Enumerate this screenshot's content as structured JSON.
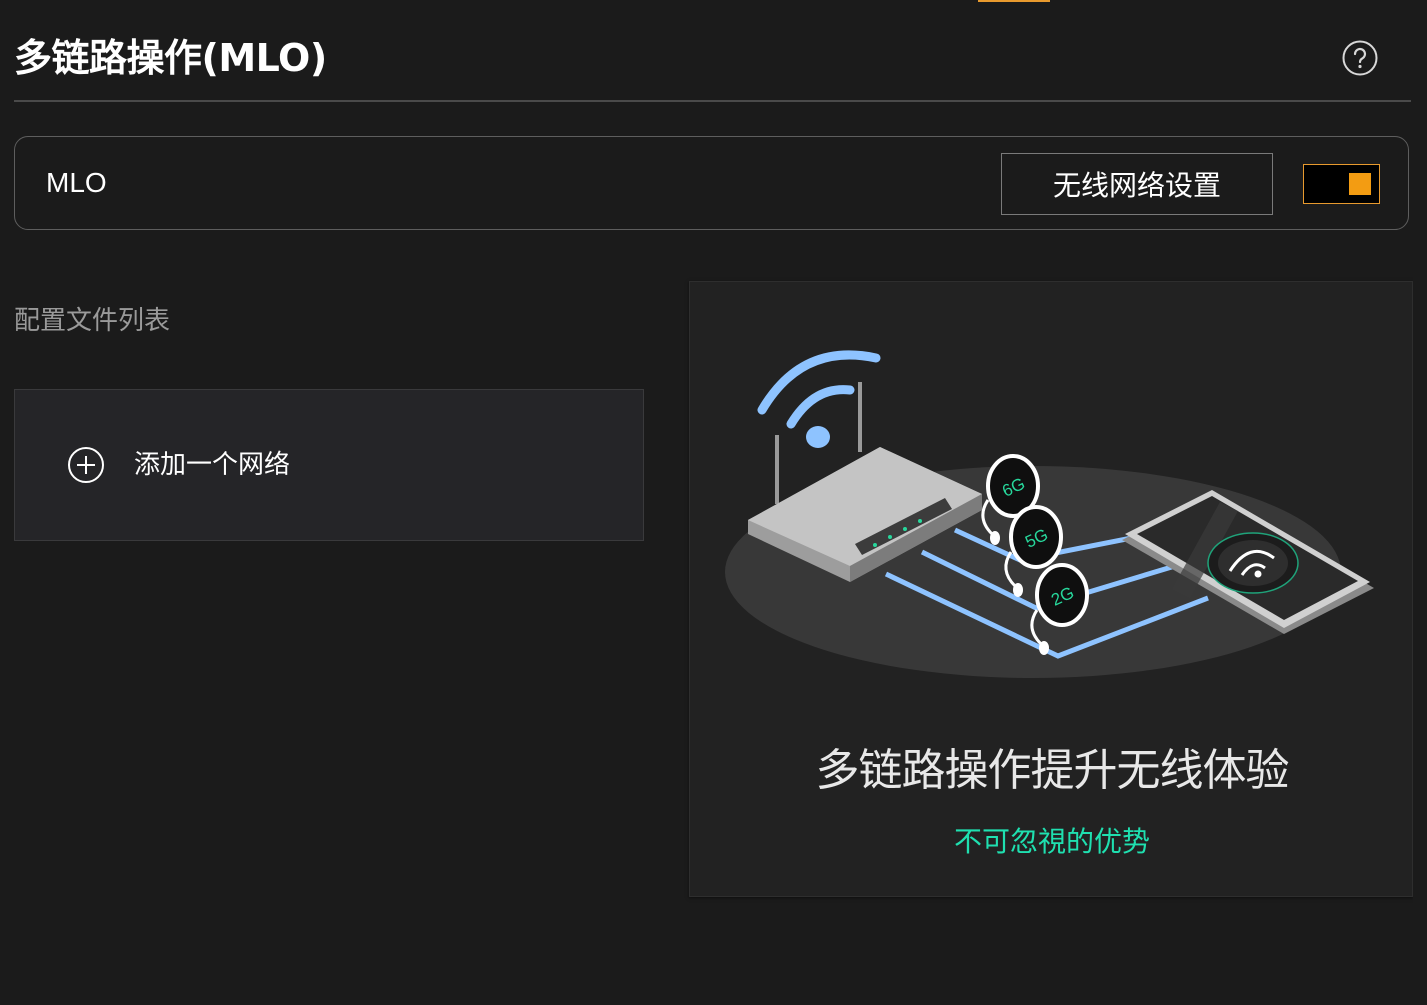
{
  "header": {
    "title": "多链路操作(MLO)",
    "help_icon": "help-circle-icon"
  },
  "mlo": {
    "label": "MLO",
    "wifi_settings_label": "无线网络设置",
    "enabled": true,
    "accent_color": "#f39c12"
  },
  "profiles": {
    "heading": "配置文件列表",
    "add_icon": "plus-circle-icon",
    "add_label": "添加一个网络"
  },
  "promo": {
    "band_labels": [
      "6G",
      "5G",
      "2G"
    ],
    "headline": "多链路操作提升无线体验",
    "subline": "不可忽視的优势",
    "subline_color": "#1fe0b0",
    "link_color": "#8ec3ff"
  }
}
